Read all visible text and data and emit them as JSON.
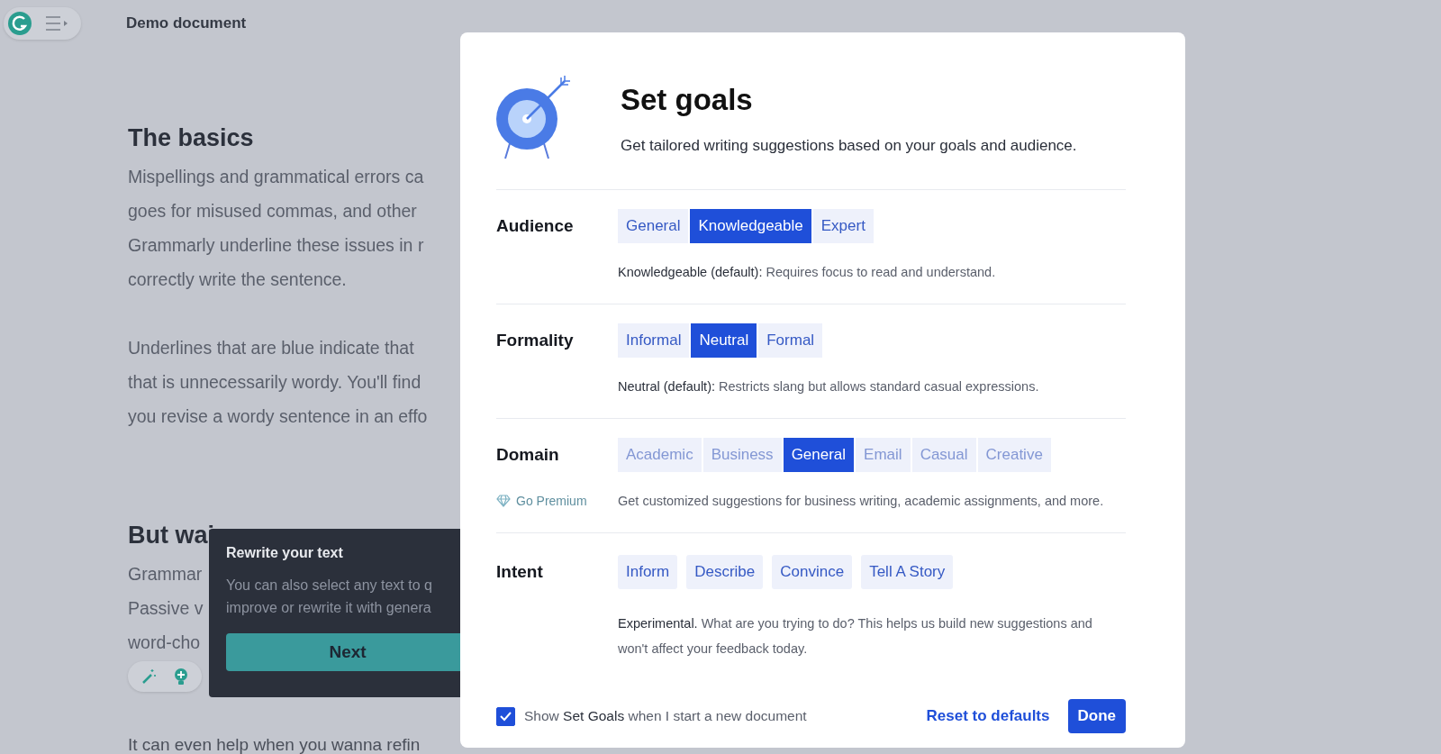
{
  "document": {
    "title": "Demo document",
    "blocks": [
      {
        "kind": "heading",
        "lines": [
          "The basics"
        ]
      },
      {
        "kind": "paragraph",
        "lines": [
          "Mispellings and grammatical errors ca",
          "goes for misused commas, and other",
          "Grammarly underline these issues in r",
          "correctly write the sentence."
        ]
      },
      {
        "kind": "paragraph",
        "lines": [
          "Underlines that are blue indicate that",
          "that is unnecessarily wordy. You'll find",
          "you revise a wordy sentence in an effo"
        ]
      },
      {
        "kind": "heading",
        "lines": [
          "But wai"
        ]
      },
      {
        "kind": "paragraph",
        "lines": [
          "Grammar",
          "Passive v",
          "word-cho"
        ]
      }
    ],
    "bottom_line": "It can even help when you wanna refin"
  },
  "tooltip": {
    "title": "Rewrite your text",
    "lines": [
      "You can also select any text to q",
      "improve or rewrite it with genera"
    ],
    "button": "Next"
  },
  "dialog": {
    "title": "Set goals",
    "subtitle": "Get tailored writing suggestions based on your goals and audience.",
    "sections": [
      {
        "label": "Audience",
        "kind": "segmented",
        "options": [
          {
            "label": "General",
            "selected": false,
            "disabled": false
          },
          {
            "label": "Knowledgeable",
            "selected": true,
            "disabled": false
          },
          {
            "label": "Expert",
            "selected": false,
            "disabled": false
          }
        ],
        "note": "**Knowledgeable (default):** Requires focus to read and understand."
      },
      {
        "label": "Formality",
        "kind": "segmented",
        "options": [
          {
            "label": "Informal",
            "selected": false,
            "disabled": false
          },
          {
            "label": "Neutral",
            "selected": true,
            "disabled": false
          },
          {
            "label": "Formal",
            "selected": false,
            "disabled": false
          }
        ],
        "note": "**Neutral (default):** Restricts slang but allows standard casual expressions."
      },
      {
        "label": "Domain",
        "kind": "segmented",
        "premium": "Go Premium",
        "options": [
          {
            "label": "Academic",
            "selected": false,
            "disabled": true
          },
          {
            "label": "Business",
            "selected": false,
            "disabled": true
          },
          {
            "label": "General",
            "selected": true,
            "disabled": false
          },
          {
            "label": "Email",
            "selected": false,
            "disabled": true
          },
          {
            "label": "Casual",
            "selected": false,
            "disabled": true
          },
          {
            "label": "Creative",
            "selected": false,
            "disabled": true
          }
        ],
        "note": "Get customized suggestions for business writing, academic assignments, and more."
      },
      {
        "label": "Intent",
        "kind": "pills",
        "options": [
          {
            "label": "Inform",
            "selected": false,
            "disabled": false
          },
          {
            "label": "Describe",
            "selected": false,
            "disabled": false
          },
          {
            "label": "Convince",
            "selected": false,
            "disabled": false
          },
          {
            "label": "Tell A Story",
            "selected": false,
            "disabled": false
          }
        ],
        "note": "**Experimental.** What are you trying to do? This helps us build new suggestions and won't affect your feedback today."
      }
    ],
    "footer": {
      "checkbox": {
        "label": "Show **Set Goals** when I start a new document",
        "checked": true
      },
      "reset": "Reset to defaults",
      "done": "Done"
    }
  }
}
